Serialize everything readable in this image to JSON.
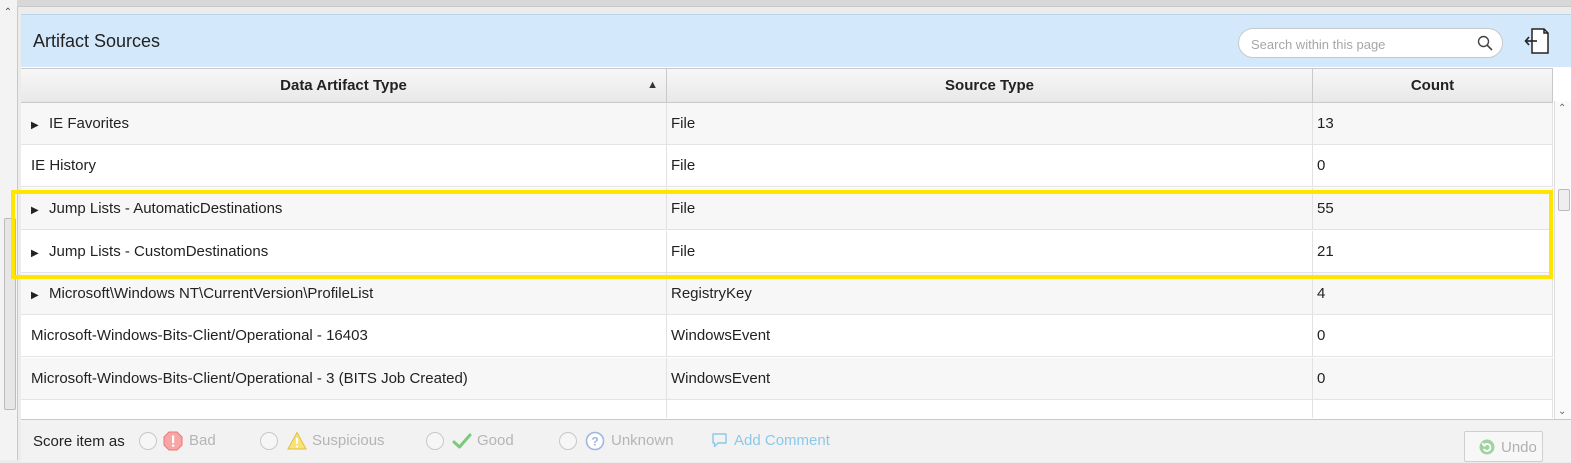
{
  "header": {
    "title": "Artifact Sources",
    "search_placeholder": "Search within this page",
    "export_icon": "export-document-icon"
  },
  "table": {
    "columns": [
      "Data Artifact Type",
      "Source Type",
      "Count"
    ],
    "sort": {
      "column": "Data Artifact Type",
      "direction": "ascending"
    },
    "rows": [
      {
        "expandable": true,
        "type": "IE Favorites",
        "source": "File",
        "count": "13"
      },
      {
        "expandable": false,
        "type": "IE History",
        "source": "File",
        "count": "0"
      },
      {
        "expandable": true,
        "type": "Jump Lists - AutomaticDestinations",
        "source": "File",
        "count": "55"
      },
      {
        "expandable": true,
        "type": "Jump Lists - CustomDestinations",
        "source": "File",
        "count": "21"
      },
      {
        "expandable": true,
        "type": "Microsoft\\Windows NT\\CurrentVersion\\ProfileList",
        "source": "RegistryKey",
        "count": "4"
      },
      {
        "expandable": false,
        "type": "Microsoft-Windows-Bits-Client/Operational - 16403",
        "source": "WindowsEvent",
        "count": "0"
      },
      {
        "expandable": false,
        "type": "Microsoft-Windows-Bits-Client/Operational - 3 (BITS Job Created)",
        "source": "WindowsEvent",
        "count": "0"
      }
    ]
  },
  "highlight": {
    "color": "#ffe500"
  },
  "footer": {
    "score_label": "Score item as",
    "options": [
      "Bad",
      "Suspicious",
      "Good",
      "Unknown"
    ],
    "add_comment": "Add Comment",
    "undo": "Undo"
  },
  "colors": {
    "header_bg": "#d3e8fb",
    "bad": "#f27a7a",
    "suspicious": "#f5d54a",
    "good": "#6cc36c",
    "unknown": "#8fb0e0"
  }
}
